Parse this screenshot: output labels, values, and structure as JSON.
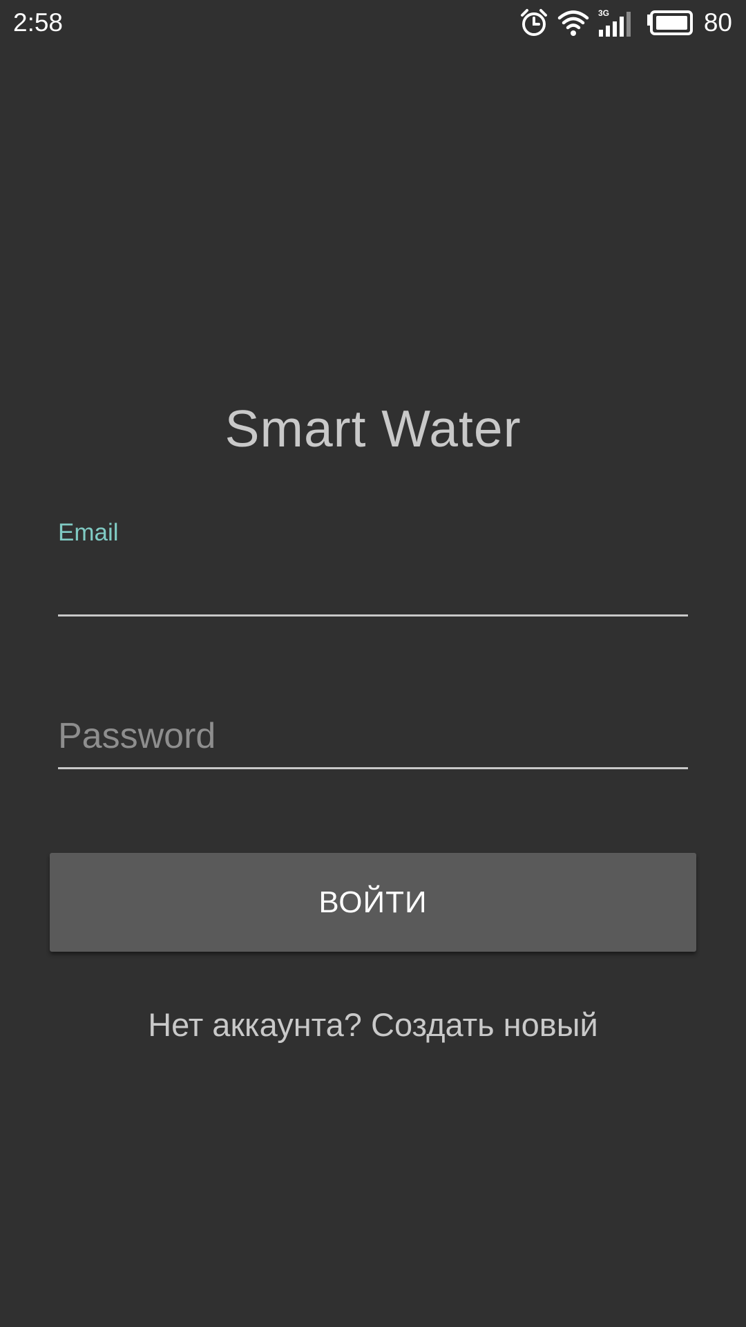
{
  "status_bar": {
    "time": "2:58",
    "battery_level": "80",
    "network_type": "3G",
    "icons": [
      "alarm-icon",
      "wifi-icon",
      "signal-icon",
      "battery-icon"
    ]
  },
  "app": {
    "title": "Smart Water"
  },
  "login_form": {
    "email_label": "Email",
    "email_value": "",
    "password_placeholder": "Password",
    "password_value": "",
    "submit_label": "ВОЙТИ",
    "register_prompt": "Нет аккаунта? Создать новый"
  },
  "colors": {
    "background": "#303030",
    "accent": "#80cbc4",
    "button": "#5a5a5a",
    "text_primary": "#c9c9c9"
  }
}
